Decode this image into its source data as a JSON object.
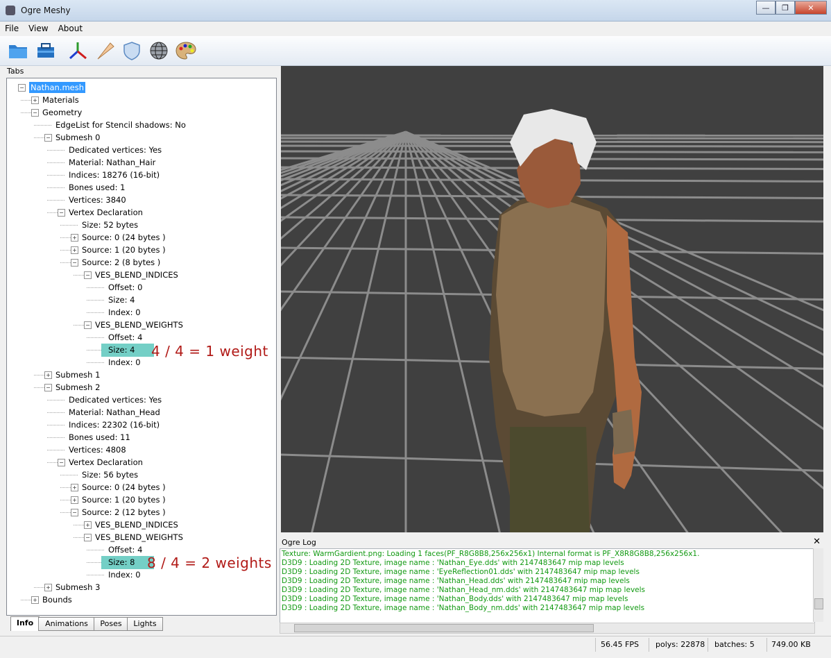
{
  "window": {
    "title": "Ogre Meshy"
  },
  "menu": [
    "File",
    "View",
    "About"
  ],
  "tabs_label": "Tabs",
  "tree": [
    {
      "label": "Nathan.mesh",
      "depth": 0,
      "expander": "-",
      "selected": true
    },
    {
      "label": "Materials",
      "depth": 1,
      "expander": "+"
    },
    {
      "label": "Geometry",
      "depth": 1,
      "expander": "-"
    },
    {
      "label": "EdgeList for Stencil shadows: No",
      "depth": 2
    },
    {
      "label": "Submesh 0",
      "depth": 2,
      "expander": "-"
    },
    {
      "label": "Dedicated vertices: Yes",
      "depth": 3
    },
    {
      "label": "Material: Nathan_Hair",
      "depth": 3
    },
    {
      "label": "Indices: 18276 (16-bit)",
      "depth": 3
    },
    {
      "label": "Bones used: 1",
      "depth": 3
    },
    {
      "label": "Vertices: 3840",
      "depth": 3
    },
    {
      "label": "Vertex Declaration",
      "depth": 3,
      "expander": "-"
    },
    {
      "label": "Size: 52 bytes",
      "depth": 4
    },
    {
      "label": "Source: 0  (24 bytes )",
      "depth": 4,
      "expander": "+"
    },
    {
      "label": "Source: 1  (20 bytes )",
      "depth": 4,
      "expander": "+"
    },
    {
      "label": "Source: 2  (8 bytes )",
      "depth": 4,
      "expander": "-"
    },
    {
      "label": "VES_BLEND_INDICES",
      "depth": 5,
      "expander": "-"
    },
    {
      "label": "Offset: 0",
      "depth": 6
    },
    {
      "label": "Size: 4",
      "depth": 6
    },
    {
      "label": "Index: 0",
      "depth": 6
    },
    {
      "label": "VES_BLEND_WEIGHTS",
      "depth": 5,
      "expander": "-"
    },
    {
      "label": "Offset: 4",
      "depth": 6
    },
    {
      "label": "Size: 4",
      "depth": 6,
      "highlight": true
    },
    {
      "label": "Index: 0",
      "depth": 6
    },
    {
      "label": "Submesh 1",
      "depth": 2,
      "expander": "+"
    },
    {
      "label": "Submesh 2",
      "depth": 2,
      "expander": "-"
    },
    {
      "label": "Dedicated vertices: Yes",
      "depth": 3
    },
    {
      "label": "Material: Nathan_Head",
      "depth": 3
    },
    {
      "label": "Indices: 22302 (16-bit)",
      "depth": 3
    },
    {
      "label": "Bones used: 11",
      "depth": 3
    },
    {
      "label": "Vertices: 4808",
      "depth": 3
    },
    {
      "label": "Vertex Declaration",
      "depth": 3,
      "expander": "-"
    },
    {
      "label": "Size: 56 bytes",
      "depth": 4
    },
    {
      "label": "Source: 0  (24 bytes )",
      "depth": 4,
      "expander": "+"
    },
    {
      "label": "Source: 1  (20 bytes )",
      "depth": 4,
      "expander": "+"
    },
    {
      "label": "Source: 2  (12 bytes )",
      "depth": 4,
      "expander": "-"
    },
    {
      "label": "VES_BLEND_INDICES",
      "depth": 5,
      "expander": "+"
    },
    {
      "label": "VES_BLEND_WEIGHTS",
      "depth": 5,
      "expander": "-"
    },
    {
      "label": "Offset: 4",
      "depth": 6
    },
    {
      "label": "Size: 8",
      "depth": 6,
      "highlight": true
    },
    {
      "label": "Index: 0",
      "depth": 6
    },
    {
      "label": "Submesh 3",
      "depth": 2,
      "expander": "+"
    },
    {
      "label": "Bounds",
      "depth": 1,
      "expander": "+"
    }
  ],
  "annotations": {
    "first": "4 / 4 = 1 weight",
    "second": "8 / 4 = 2 weights"
  },
  "bottom_tabs": [
    "Info",
    "Animations",
    "Poses",
    "Lights"
  ],
  "log": {
    "title": "Ogre Log",
    "lines": [
      "Texture: WarmGardient.png: Loading 1 faces(PF_R8G8B8,256x256x1) Internal format is PF_X8R8G8B8,256x256x1.",
      "D3D9 : Loading 2D Texture, image name : 'Nathan_Eye.dds' with 2147483647 mip map levels",
      "D3D9 : Loading 2D Texture, image name : 'EyeReflection01.dds' with 2147483647 mip map levels",
      "D3D9 : Loading 2D Texture, image name : 'Nathan_Head.dds' with 2147483647 mip map levels",
      "D3D9 : Loading 2D Texture, image name : 'Nathan_Head_nm.dds' with 2147483647 mip map levels",
      "D3D9 : Loading 2D Texture, image name : 'Nathan_Body.dds' with 2147483647 mip map levels",
      "D3D9 : Loading 2D Texture, image name : 'Nathan_Body_nm.dds' with 2147483647 mip map levels"
    ],
    "color": "#119911"
  },
  "status": {
    "fps": "56.45 FPS",
    "polys": "polys: 22878",
    "batches": "batches: 5",
    "memory": "749.00 KB"
  },
  "colors": {
    "selection": "#3399ff",
    "highlight": "#74cfc6",
    "annotation": "#b11a17",
    "viewport_bg": "#404040"
  }
}
